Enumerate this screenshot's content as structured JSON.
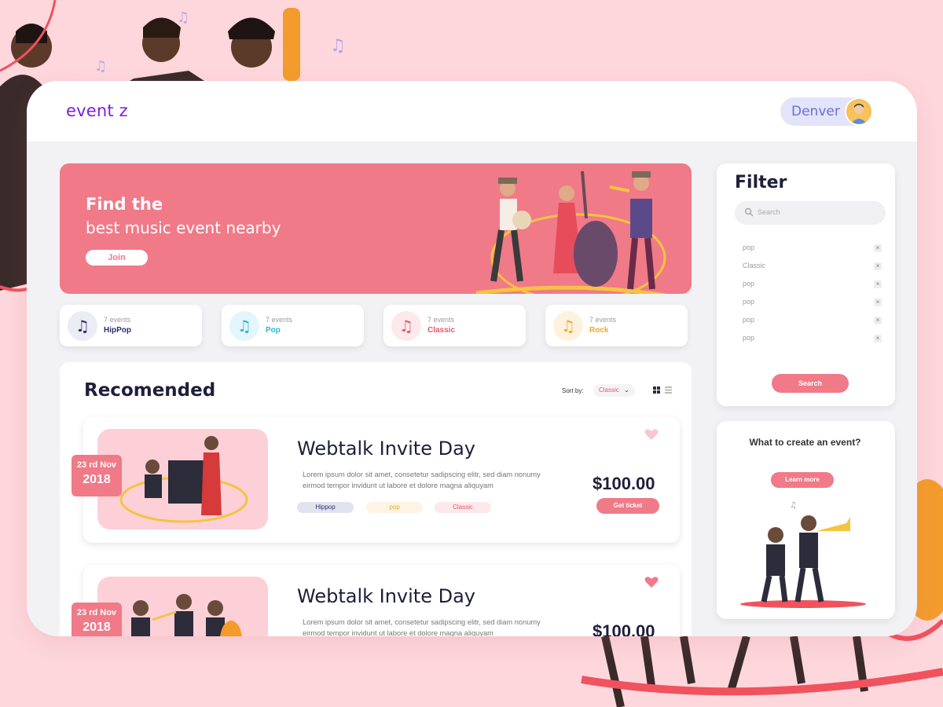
{
  "app": {
    "logo": "event z"
  },
  "user": {
    "name": "Denver"
  },
  "hero": {
    "title": "Find the",
    "subtitle": "best music event nearby",
    "join_label": "Join"
  },
  "categories": [
    {
      "count": "7 events",
      "name": "HipPop",
      "color": "#2c2c6e",
      "bg": "#ececf5",
      "icon": "music-note-icon"
    },
    {
      "count": "7 events",
      "name": "Pop",
      "color": "#29b6d8",
      "bg": "#e3f6fb",
      "icon": "music-note-icon"
    },
    {
      "count": "7 events",
      "name": "Classic",
      "color": "#e0596a",
      "bg": "#fde8eb",
      "icon": "music-note-icon"
    },
    {
      "count": "7 events",
      "name": "Rock",
      "color": "#f1a72c",
      "bg": "#fdf2e0",
      "icon": "music-note-icon"
    }
  ],
  "recommended": {
    "title": "Recomended",
    "sort_label": "Sort by:",
    "sort_value": "Classic",
    "events": [
      {
        "date_day": "23 rd Nov",
        "date_year": "2018",
        "title": "Webtalk Invite Day",
        "description": "Lorem ipsum dolor sit amet, consetetur sadipscing elitr, sed diam nonumy eirmod tempor invidunt ut labore et dolore magna aliquyam",
        "tags": [
          "Hippop",
          "pop",
          "Classic"
        ],
        "price": "$100.00",
        "ticket_label": "Get ticket"
      },
      {
        "date_day": "23 rd Nov",
        "date_year": "2018",
        "title": "Webtalk Invite Day",
        "description": "Lorem ipsum dolor sit amet, consetetur sadipscing elitr, sed diam nonumy eirmod tempor invidunt ut labore et dolore magna aliquyam",
        "tags": [],
        "price": "$100.00",
        "ticket_label": ""
      }
    ]
  },
  "filter": {
    "title": "Filter",
    "search_placeholder": "Search",
    "items": [
      "pop",
      "Classic",
      "pop",
      "pop",
      "pop",
      "pop"
    ],
    "search_button": "Search"
  },
  "create": {
    "question": "What to create an event?",
    "learn_more": "Learn more"
  },
  "colors": {
    "accent": "#f07a88",
    "logo": "#7a1fe0",
    "background": "#fdd7dc"
  }
}
